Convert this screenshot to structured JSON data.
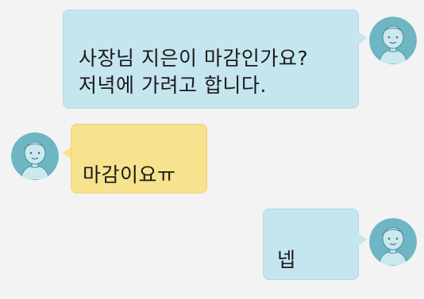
{
  "messages": [
    {
      "sender": "me",
      "text": "사장님 지은이 마감인가요?\n저녁에 가려고 합니다.",
      "avatar_icon": "person-avatar-icon"
    },
    {
      "sender": "other",
      "text": "마감이요ㅠ",
      "avatar_icon": "person-avatar-icon"
    },
    {
      "sender": "me",
      "text": "넵",
      "avatar_icon": "person-avatar-icon"
    }
  ],
  "colors": {
    "background": "#f3f3f3",
    "my_bubble": "#c5e5ef",
    "their_bubble": "#f7e28d",
    "avatar_bg": "#6fb6c4",
    "avatar_face": "#cbe8ee"
  }
}
